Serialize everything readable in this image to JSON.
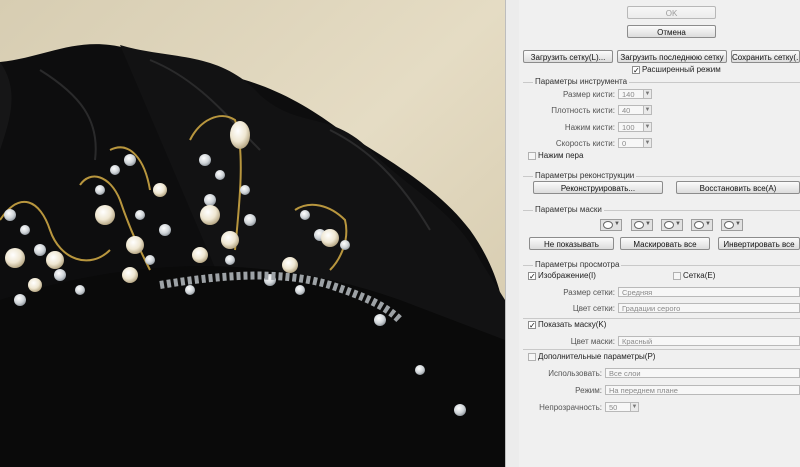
{
  "buttons": {
    "ok": "OK",
    "cancel": "Отмена",
    "load_mesh": "Загрузить сетку(L)...",
    "load_last_mesh": "Загрузить последнюю сетку",
    "save_mesh": "Сохранить сетку(...)",
    "advanced_mode": "Расширенный режим"
  },
  "tool_options": {
    "title": "Параметры инструмента",
    "brush_size": {
      "label": "Размер кисти:",
      "value": "140"
    },
    "brush_density": {
      "label": "Плотность кисти:",
      "value": "40"
    },
    "brush_pressure": {
      "label": "Нажим кисти:",
      "value": "100"
    },
    "brush_rate": {
      "label": "Скорость кисти:",
      "value": "0"
    },
    "stylus_pressure": "Нажим пера"
  },
  "reconstruct": {
    "title": "Параметры реконструкции",
    "reconstruct_btn": "Реконструировать...",
    "restore_all_btn": "Восстановить все(A)"
  },
  "mask": {
    "title": "Параметры маски",
    "none_btn": "Не показывать",
    "mask_all_btn": "Маскировать все",
    "invert_all_btn": "Инвертировать все"
  },
  "view": {
    "title": "Параметры просмотра",
    "show_image": "Изображение(I)",
    "show_mesh": "Сетка(E)",
    "mesh_size": {
      "label": "Размер сетки:",
      "value": "Средняя"
    },
    "mesh_color": {
      "label": "Цвет сетки:",
      "value": "Градации серого"
    },
    "show_mask": "Показать маску(K)",
    "mask_color": {
      "label": "Цвет маски:",
      "value": "Красный"
    }
  },
  "backdrop": {
    "title": "Дополнительные параметры(P)",
    "use": {
      "label": "Использовать:",
      "value": "Все слои"
    },
    "mode": {
      "label": "Режим:",
      "value": "На переднем плане"
    },
    "opacity": {
      "label": "Непрозрачность:",
      "value": "50"
    }
  },
  "colors": {
    "panel_bg": "#f0f0f0",
    "photo_bg": "#ddd2b8",
    "hair": "#0d0d0e"
  },
  "icons": [
    "checkmark-icon",
    "dropdown-arrow-icon",
    "mask-replace-icon",
    "mask-add-icon",
    "mask-subtract-icon",
    "mask-intersect-icon",
    "mask-invert-icon"
  ]
}
